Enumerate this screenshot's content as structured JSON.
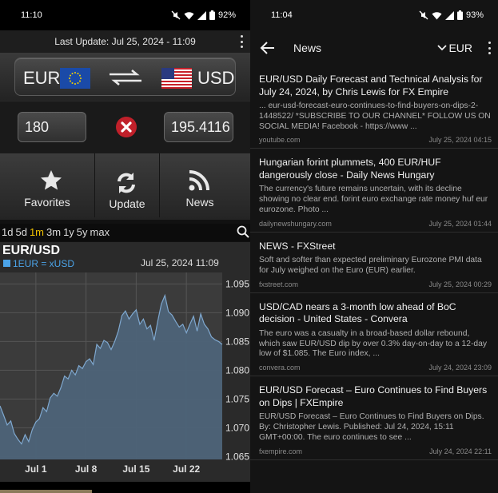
{
  "left": {
    "status": {
      "time": "11:10",
      "battery": "92%"
    },
    "last_update": "Last Update: Jul 25, 2024 - 11:09",
    "from_currency": "EUR",
    "to_currency": "USD",
    "amount": "180",
    "result": "195.4116",
    "actions": [
      {
        "label": "Favorites",
        "icon": "star-icon"
      },
      {
        "label": "Update",
        "icon": "refresh-icon"
      },
      {
        "label": "News",
        "icon": "rss-icon"
      }
    ],
    "ranges": [
      "1d",
      "5d",
      "1m",
      "3m",
      "1y",
      "5y",
      "max"
    ],
    "active_range": "1m",
    "colors": {
      "accent": "#f0c000",
      "series": "#4ba3e8",
      "clear": "#c0202a"
    }
  },
  "chart_data": {
    "type": "area",
    "title": "EUR/USD",
    "legend": "1EUR = xUSD",
    "date_label": "Jul 25, 2024 11:09",
    "x_ticks": [
      "Jul 1",
      "Jul 8",
      "Jul 15",
      "Jul 22"
    ],
    "y_ticks": [
      1.065,
      1.07,
      1.075,
      1.08,
      1.085,
      1.09,
      1.095
    ],
    "ylim": [
      1.0645,
      1.097
    ],
    "xlim": [
      0,
      31
    ],
    "x_tick_positions": [
      5,
      12,
      19,
      26
    ],
    "grid": true,
    "x": [
      0,
      0.5,
      1,
      1.5,
      2,
      2.5,
      3,
      3.5,
      4,
      4.5,
      5,
      5.5,
      6,
      6.5,
      7,
      7.5,
      8,
      8.5,
      9,
      9.5,
      10,
      10.5,
      11,
      11.5,
      12,
      12.5,
      13,
      13.5,
      14,
      14.5,
      15,
      15.5,
      16,
      16.5,
      17,
      17.5,
      18,
      18.5,
      19,
      19.5,
      20,
      20.5,
      21,
      21.5,
      22,
      22.5,
      23,
      23.5,
      24,
      24.5,
      25,
      25.5,
      26,
      26.5,
      27,
      27.5,
      28,
      28.5,
      29,
      29.5,
      30,
      30.5,
      31
    ],
    "values": [
      1.0738,
      1.0722,
      1.0705,
      1.0712,
      1.069,
      1.068,
      1.0672,
      1.0688,
      1.0676,
      1.0697,
      1.071,
      1.0716,
      1.0735,
      1.0728,
      1.0752,
      1.076,
      1.0755,
      1.077,
      1.079,
      1.0785,
      1.08,
      1.0792,
      1.0808,
      1.0803,
      1.0815,
      1.082,
      1.081,
      1.0845,
      1.0838,
      1.0852,
      1.0848,
      1.0836,
      1.085,
      1.0868,
      1.0895,
      1.0903,
      1.0889,
      1.0898,
      1.0905,
      1.088,
      1.0889,
      1.0872,
      1.0878,
      1.0852,
      1.0885,
      1.0915,
      1.093,
      1.0902,
      1.0896,
      1.0885,
      1.0875,
      1.088,
      1.0865,
      1.088,
      1.0894,
      1.0868,
      1.0898,
      1.088,
      1.0872,
      1.0858,
      1.0853,
      1.085,
      1.0845
    ]
  },
  "right": {
    "status": {
      "time": "11:04",
      "battery": "93%"
    },
    "title": "News",
    "currency": "EUR",
    "items": [
      {
        "title": "EUR/USD Daily Forecast and Technical Analysis for July 24, 2024, by Chris Lewis for FX Empire",
        "snippet": "... eur-usd-forecast-euro-continues-to-find-buyers-on-dips-2-1448522/ *SUBSCRIBE TO OUR CHANNEL* FOLLOW US ON SOCIAL MEDIA! Facebook - https://www ...",
        "source": "youtube.com",
        "date": "July 25, 2024 04:15"
      },
      {
        "title": "Hungarian forint plummets, 400 EUR/HUF dangerously close - Daily News Hungary",
        "snippet": "The currency's future remains uncertain, with its decline showing no clear end. forint euro exchange rate money huf eur eurozone. Photo ...",
        "source": "dailynewshungary.com",
        "date": "July 25, 2024 01:44"
      },
      {
        "title": "NEWS - FXStreet",
        "snippet": "Soft and softer than expected preliminary Eurozone PMI data for July weighed on the Euro (EUR) earlier.",
        "source": "fxstreet.com",
        "date": "July 25, 2024 00:29"
      },
      {
        "title": "USD/CAD nears a 3-month low ahead of BoC decision - United States - Convera",
        "snippet": "The euro was a casualty in a broad-based dollar rebound, which saw EUR/USD dip by over 0.3% day-on-day to a 12-day low of $1.085. The Euro index, ...",
        "source": "convera.com",
        "date": "July 24, 2024 23:09"
      },
      {
        "title": "EUR/USD Forecast – Euro Continues to Find Buyers on Dips | FXEmpire",
        "snippet": "EUR/USD Forecast – Euro Continues to Find Buyers on Dips. By: Christopher Lewis. Published: Jul 24, 2024, 15:11 GMT+00:00. The euro continues to see ...",
        "source": "fxempire.com",
        "date": "July 24, 2024 22:11"
      }
    ]
  }
}
